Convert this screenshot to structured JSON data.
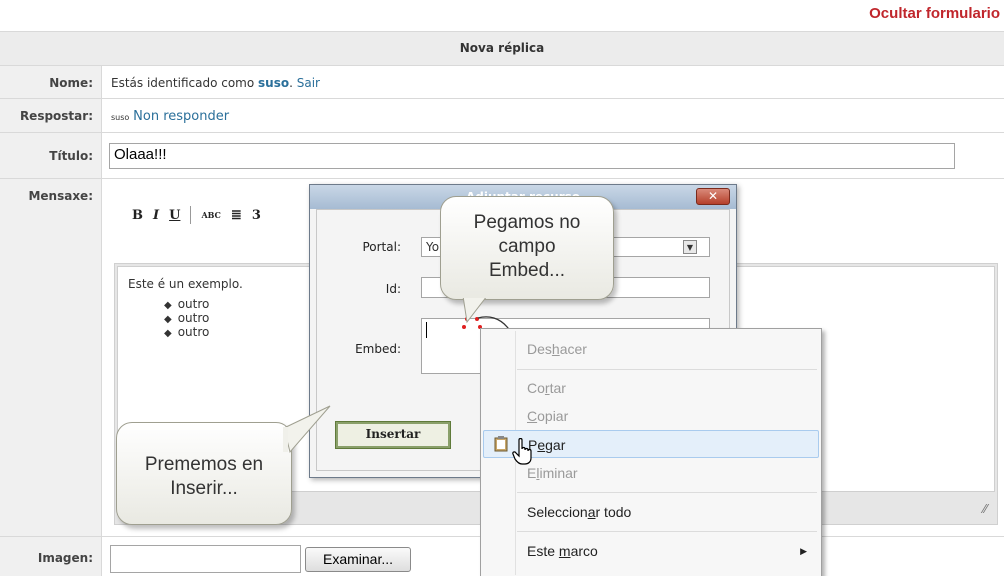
{
  "top_link": "Ocultar formulario",
  "form": {
    "header": "Nova réplica",
    "name_label": "Nome:",
    "name_text_before": "Estás identificado como ",
    "name_user": "suso",
    "name_text_after": ".",
    "name_logout": "Sair",
    "reply_label": "Respostar:",
    "reply_user": "suso",
    "reply_link": "Non responder",
    "title_label": "Título:",
    "title_value": "Olaaa!!!",
    "message_label": "Mensaxe:",
    "image_label": "Imagen:",
    "browse_button": "Examinar..."
  },
  "toolbar": {
    "bold": "B",
    "italic": "I",
    "underline": "U",
    "spellcheck": "ABC",
    "align": "≣",
    "more": "3"
  },
  "editor": {
    "text": "Este é un exemplo.",
    "items": [
      "outro",
      "outro",
      "outro"
    ]
  },
  "dialog": {
    "title": "Adjuntar recurso",
    "close": "✕",
    "portal_label": "Portal:",
    "portal_value": "Yo",
    "id_label": "Id:",
    "embed_label": "Embed:",
    "insert_button": "Insertar"
  },
  "callouts": {
    "top_line1": "Pegamos no",
    "top_line2": "campo",
    "top_line3": "Embed...",
    "bottom_line1": "Prememos en",
    "bottom_line2": "Inserir..."
  },
  "context_menu": {
    "undo_a": "Des",
    "undo_u": "h",
    "undo_b": "acer",
    "cut_a": "Co",
    "cut_u": "r",
    "cut_b": "tar",
    "copy_a": "",
    "copy_u": "C",
    "copy_b": "opiar",
    "paste_a": "P",
    "paste_u": "e",
    "paste_b": "gar",
    "delete_a": "E",
    "delete_u": "l",
    "delete_b": "iminar",
    "selectall_a": "Seleccion",
    "selectall_u": "a",
    "selectall_b": "r todo",
    "frame_a": "Este ",
    "frame_u": "m",
    "frame_b": "arco"
  },
  "colors": {
    "accent_red": "#c0262c",
    "link_blue": "#2a6f9a"
  }
}
